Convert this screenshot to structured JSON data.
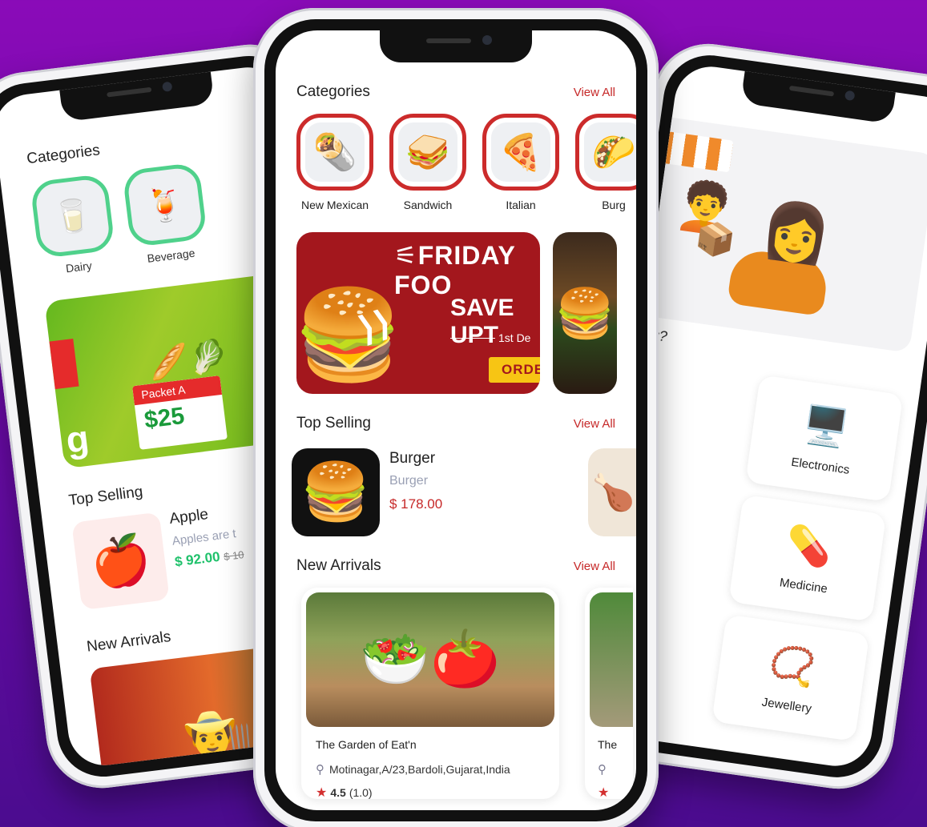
{
  "left_phone": {
    "categories_title": "Categories",
    "categories": [
      {
        "label": "Dairy",
        "icon": "🥛"
      },
      {
        "label": "Beverage",
        "icon": "🍹"
      }
    ],
    "banner": {
      "big_text": "g",
      "packet_tag": "Packet A",
      "packet_price": "$25"
    },
    "top_selling_title": "Top Selling",
    "product": {
      "name": "Apple",
      "desc": "Apples are t",
      "price": "$ 92.00",
      "old_price": "$ 10"
    },
    "new_arrivals_title": "New Arrivals"
  },
  "center_phone": {
    "categories_title": "Categories",
    "view_all": "View All",
    "categories": [
      {
        "label": "New Mexican",
        "icon": "🌯"
      },
      {
        "label": "Sandwich",
        "icon": "🥪"
      },
      {
        "label": "Italian",
        "icon": "🍕"
      },
      {
        "label": "Burg",
        "icon": "🌮"
      }
    ],
    "banner": {
      "line1": "⚟FRIDAY FOO",
      "line2": "SAVE UPT",
      "date": "1st De",
      "cta": "ORDE"
    },
    "top_selling_title": "Top Selling",
    "top_selling": {
      "name": "Burger",
      "sub": "Burger",
      "price": "$ 178.00"
    },
    "new_arrivals_title": "New Arrivals",
    "restaurant": {
      "name": "The Garden of Eat'n",
      "address": "Motinagar,A/23,Bardoli,Gujarat,India",
      "rating": "4.5",
      "rating_count": "(1.0)"
    },
    "restaurant_peek": {
      "name": "The"
    }
  },
  "right_phone": {
    "question": "lling?",
    "services": [
      {
        "label": "Electronics",
        "icon": "🖥️"
      },
      {
        "label": "Medicine",
        "icon": "💊"
      },
      {
        "label": "Jewellery",
        "icon": "📿"
      }
    ]
  },
  "colors": {
    "background_top": "#8a0bb8",
    "background_bottom": "#4b0c8f",
    "accent_red": "#c62828",
    "accent_green": "#4fd18b"
  }
}
